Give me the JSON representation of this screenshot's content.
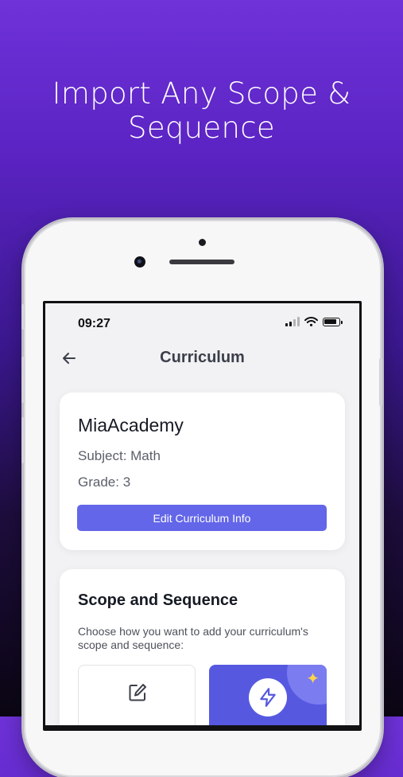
{
  "headline": {
    "line1": "Import Any Scope &",
    "line2": "Sequence"
  },
  "status_bar": {
    "time": "09:27"
  },
  "nav": {
    "title": "Curriculum"
  },
  "curriculum_card": {
    "name": "MiaAcademy",
    "subject": "Subject: Math",
    "grade": "Grade: 3",
    "edit_button": "Edit Curriculum Info"
  },
  "scope_card": {
    "title": "Scope and Sequence",
    "description": "Choose how you want to add your curriculum's scope and sequence:",
    "options": [
      {
        "icon": "edit-icon"
      },
      {
        "icon": "lightning-icon",
        "badge_icon": "sparkle-icon"
      }
    ]
  },
  "colors": {
    "accent": "#6366e8",
    "ai_option": "#5659e0",
    "background_top": "#6f32d9",
    "background_bottom": "#0b0613"
  }
}
